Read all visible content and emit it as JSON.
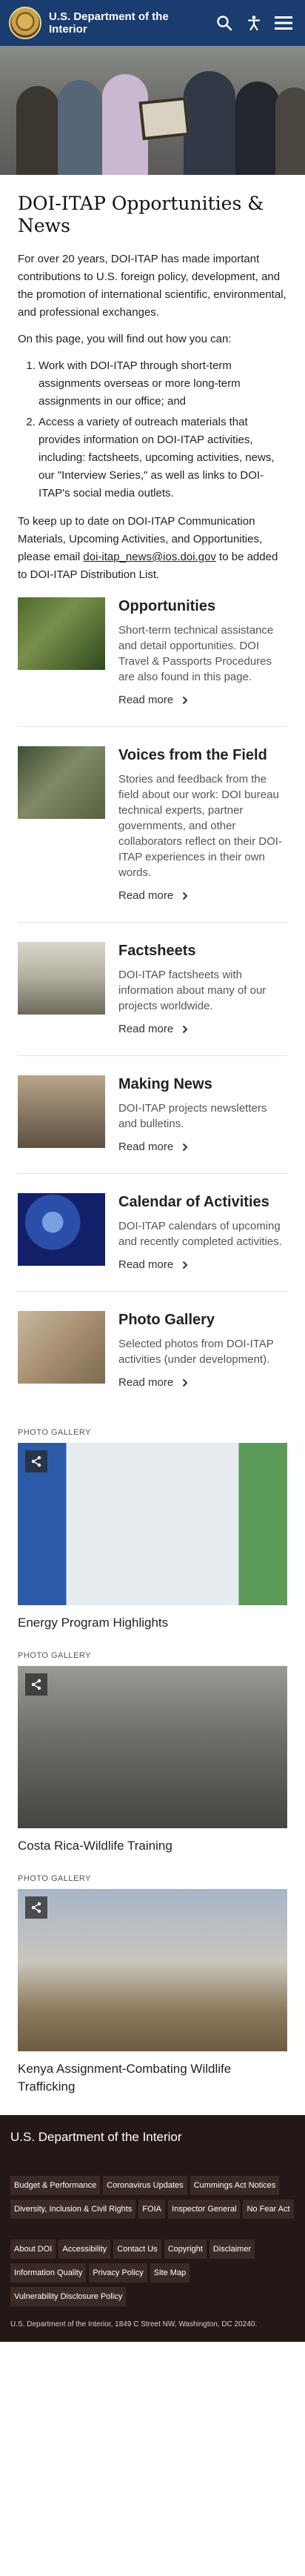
{
  "header": {
    "title_line1": "U.S. Department of the",
    "title_line2": "Interior"
  },
  "main": {
    "title": "DOI-ITAP Opportunities & News",
    "intro_p1": "For over 20 years, DOI-ITAP has made important contributions to U.S. foreign policy, development, and the promotion of international scientific, environmental, and professional exchanges.",
    "intro_p2": "On this page, you will find out how you can:",
    "list": [
      "Work with DOI-ITAP through short-term assignments overseas or more long-term assignments in our office; and",
      "Access a variety of outreach materials that provides information on DOI-ITAP activities, including: factsheets, upcoming activities, news, our \"Interview Series,\" as well as links to DOI-ITAP's social media outlets."
    ],
    "intro_p3_before": "To keep up to date on DOI-ITAP Communication Materials, Upcoming Activities, and Opportunities, please email ",
    "intro_p3_link": "doi-itap_news@ios.doi.gov",
    "intro_p3_after": " to be added to DOI-ITAP Distribution List."
  },
  "cards": [
    {
      "title": "Opportunities",
      "text": "Short-term technical assistance and detail opportunities. DOI Travel & Passports Procedures are also found in this page.",
      "link": "Read more"
    },
    {
      "title": "Voices from the Field",
      "text": "Stories and feedback from the field about our work: DOI bureau technical experts, partner governments, and other collaborators reflect on their DOI-ITAP experiences in their own words.",
      "link": "Read more"
    },
    {
      "title": "Factsheets",
      "text": "DOI-ITAP factsheets with information about many of our projects worldwide.",
      "link": "Read more"
    },
    {
      "title": "Making News",
      "text": "DOI-ITAP projects newsletters and bulletins.",
      "link": "Read more"
    },
    {
      "title": "Calendar of Activities",
      "text": "DOI-ITAP calendars of upcoming and recently completed activities.",
      "link": "Read more"
    },
    {
      "title": "Photo Gallery",
      "text": "Selected photos from DOI-ITAP activities (under development).",
      "link": "Read more"
    }
  ],
  "galleries": [
    {
      "tag": "PHOTO GALLERY",
      "caption": "Energy Program Highlights"
    },
    {
      "tag": "PHOTO GALLERY",
      "caption": "Costa Rica-Wildlife Training"
    },
    {
      "tag": "PHOTO GALLERY",
      "caption": "Kenya Assignment-Combating Wildlife Trafficking"
    }
  ],
  "footer": {
    "title": "U.S. Department of the Interior",
    "links_group1": [
      "Budget & Performance",
      "Coronavirus Updates",
      "Cummings Act Notices",
      "Diversity, Inclusion & Civil Rights",
      "FOIA",
      "Inspector General",
      "No Fear Act"
    ],
    "links_group2": [
      "About DOI",
      "Accessibility",
      "Contact Us",
      "Copyright",
      "Disclaimer",
      "Information Quality",
      "Privacy Policy",
      "Site Map",
      "Vulnerability Disclosure Policy"
    ],
    "address": "U.S. Department of the Interior, 1849 C Street NW, Washington, DC 20240."
  },
  "icons": {
    "search": "search-icon",
    "accessibility": "accessibility-icon",
    "menu": "hamburger-menu-icon",
    "share": "share-icon",
    "chevron": "chevron-right-icon"
  },
  "colors": {
    "header_bg": "#1a3c6e",
    "footer_bg": "#241816"
  }
}
